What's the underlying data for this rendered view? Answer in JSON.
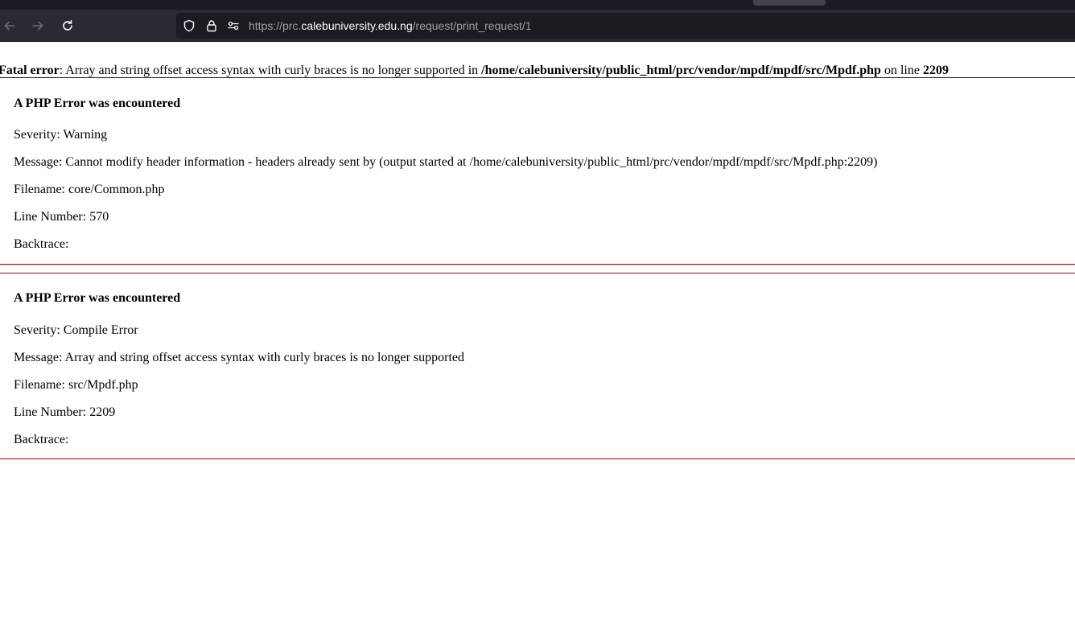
{
  "browser": {
    "url_prefix": "https://prc.",
    "url_host": "calebuniversity.edu.ng",
    "url_path": "/request/print_request/1",
    "icons": [
      "back-arrow-icon",
      "forward-arrow-icon",
      "reload-icon",
      "tracking-shield-icon",
      "lock-icon",
      "permissions-icon"
    ]
  },
  "fatal": {
    "label": "Fatal error",
    "message_before": ": Array and string offset access syntax with curly braces is no longer supported in ",
    "file": "/home/calebuniversity/public_html/prc/vendor/mpdf/mpdf/src/Mpdf.php",
    "on_line": " on line ",
    "line": "2209"
  },
  "errors": [
    {
      "heading": "A PHP Error was encountered",
      "severity": "Severity: Warning",
      "message": "Message: Cannot modify header information - headers already sent by (output started at /home/calebuniversity/public_html/prc/vendor/mpdf/mpdf/src/Mpdf.php:2209)",
      "filename": "Filename: core/Common.php",
      "line_number": "Line Number: 570",
      "backtrace": "Backtrace:"
    },
    {
      "heading": "A PHP Error was encountered",
      "severity": "Severity: Compile Error",
      "message": "Message: Array and string offset access syntax with curly braces is no longer supported",
      "filename": "Filename: src/Mpdf.php",
      "line_number": "Line Number: 2209",
      "backtrace": "Backtrace:"
    }
  ],
  "colors": {
    "error_border": "#990000",
    "chrome_bg": "#2b2a33",
    "urlbar_bg": "#1c1b22"
  }
}
